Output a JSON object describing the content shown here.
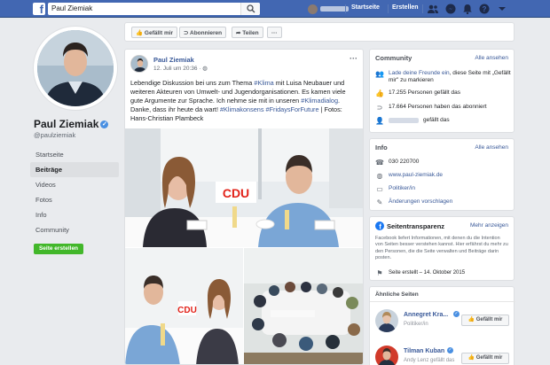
{
  "topbar": {
    "search_value": "Paul Ziemiak",
    "nav_home": "Startseite",
    "nav_create": "Erstellen"
  },
  "profile": {
    "name": "Paul Ziemiak",
    "handle": "@paulziemiak",
    "nav": [
      "Startseite",
      "Beiträge",
      "Videos",
      "Fotos",
      "Info",
      "Community"
    ],
    "active_index": 1,
    "create_button": "Seite erstellen"
  },
  "actions": {
    "like": "Gefällt mir",
    "follow": "Abonnieren",
    "share": "Teilen",
    "more": "···"
  },
  "post": {
    "author": "Paul Ziemiak",
    "meta": "12. Juli um 20:36 · ",
    "more": "···",
    "text_parts": [
      {
        "t": "Lebendige Diskussion bei uns zum Thema ",
        "h": false
      },
      {
        "t": "#Klima",
        "h": true
      },
      {
        "t": " mit Luisa Neubauer und weiteren Akteuren von Umwelt- und Jugendorganisationen. Es kamen viele gute Argumente zur Sprache. Ich nehme sie mit in unseren ",
        "h": false
      },
      {
        "t": "#Klimadialog",
        "h": true
      },
      {
        "t": ". Danke, dass ihr heute da wart! ",
        "h": false
      },
      {
        "t": "#Klimakonsens",
        "h": true
      },
      {
        "t": " ",
        "h": false
      },
      {
        "t": "#FridaysForFuture",
        "h": true
      },
      {
        "t": " | Fotos: Hans-Christian Plambeck",
        "h": false
      }
    ],
    "sign_text": "CDU"
  },
  "community": {
    "title": "Community",
    "see_all": "Alle ansehen",
    "invite_link": "Lade deine Freunde ein",
    "invite_rest": ", diese Seite mit „Gefällt mir\" zu markieren",
    "likes": "17.255 Personen gefällt das",
    "follows": "17.664 Personen haben das abonniert",
    "friend_likes": "gefällt das"
  },
  "info": {
    "title": "Info",
    "see_all": "Alle ansehen",
    "phone": "030 220700",
    "website": "www.paul-ziemiak.de",
    "category": "Politiker/in",
    "suggest": "Änderungen vorschlagen"
  },
  "transparency": {
    "title": "Seitentransparenz",
    "more": "Mehr anzeigen",
    "text": "Facebook liefert Informationen, mit denen du die Intention von Seiten besser verstehen kannst. Hier erfährst du mehr zu den Personen, die die Seite verwalten und Beiträge darin posten.",
    "created": "Seite erstellt – 14. Oktober 2015"
  },
  "similar": {
    "title": "Ähnliche Seiten",
    "pages": [
      {
        "name": "Annegret Kra...",
        "sub": "Politiker/in",
        "button": "Gefällt mir"
      },
      {
        "name": "Tilman Kuban",
        "sub": "Andy Lenz gefällt das",
        "button": "Gefällt mir"
      }
    ]
  },
  "colors": {
    "brand": "#4267b2",
    "link": "#385898",
    "green": "#42b72a"
  }
}
